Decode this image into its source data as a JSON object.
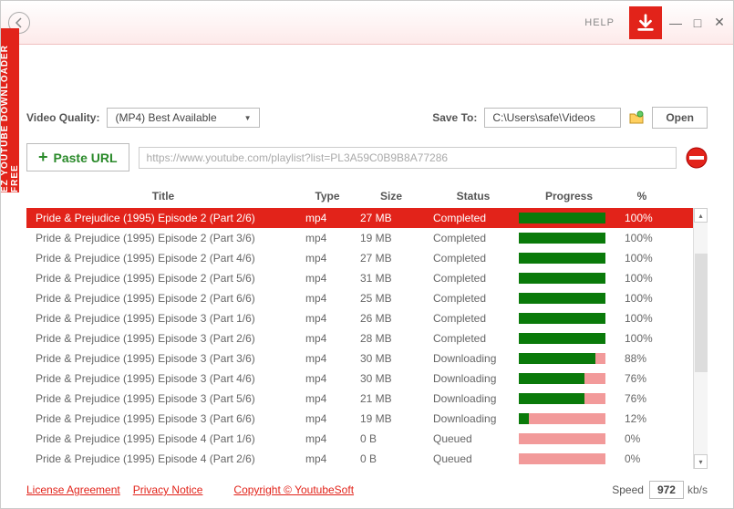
{
  "sidebar_label": "EZ YOUTUBE DOWNLOADER FREE",
  "help_label": "HELP",
  "video_quality_label": "Video Quality:",
  "video_quality_value": "(MP4) Best Available",
  "save_to_label": "Save To:",
  "save_to_path": "C:\\Users\\safe\\Videos",
  "open_label": "Open",
  "paste_url_label": "Paste URL",
  "url_value": "https://www.youtube.com/playlist?list=PL3A59C0B9B8A77286",
  "headers": {
    "title": "Title",
    "type": "Type",
    "size": "Size",
    "status": "Status",
    "progress": "Progress",
    "pct": "%"
  },
  "rows": [
    {
      "title": "Pride & Prejudice (1995) Episode 2 (Part 2/6)",
      "type": "mp4",
      "size": "27 MB",
      "status": "Completed",
      "progress": 100,
      "pct": "100%",
      "selected": true
    },
    {
      "title": "Pride & Prejudice (1995) Episode 2 (Part 3/6)",
      "type": "mp4",
      "size": "19 MB",
      "status": "Completed",
      "progress": 100,
      "pct": "100%"
    },
    {
      "title": "Pride & Prejudice (1995) Episode 2 (Part 4/6)",
      "type": "mp4",
      "size": "27 MB",
      "status": "Completed",
      "progress": 100,
      "pct": "100%"
    },
    {
      "title": "Pride & Prejudice (1995) Episode 2 (Part 5/6)",
      "type": "mp4",
      "size": "31 MB",
      "status": "Completed",
      "progress": 100,
      "pct": "100%"
    },
    {
      "title": "Pride & Prejudice (1995) Episode 2 (Part 6/6)",
      "type": "mp4",
      "size": "25 MB",
      "status": "Completed",
      "progress": 100,
      "pct": "100%"
    },
    {
      "title": "Pride & Prejudice (1995) Episode 3 (Part 1/6)",
      "type": "mp4",
      "size": "26 MB",
      "status": "Completed",
      "progress": 100,
      "pct": "100%"
    },
    {
      "title": "Pride & Prejudice (1995) Episode 3 (Part 2/6)",
      "type": "mp4",
      "size": "28 MB",
      "status": "Completed",
      "progress": 100,
      "pct": "100%"
    },
    {
      "title": "Pride & Prejudice (1995) Episode 3 (Part 3/6)",
      "type": "mp4",
      "size": "30 MB",
      "status": "Downloading",
      "progress": 88,
      "pct": "88%"
    },
    {
      "title": "Pride & Prejudice (1995) Episode 3 (Part 4/6)",
      "type": "mp4",
      "size": "30 MB",
      "status": "Downloading",
      "progress": 76,
      "pct": "76%"
    },
    {
      "title": "Pride & Prejudice (1995) Episode 3 (Part 5/6)",
      "type": "mp4",
      "size": "21 MB",
      "status": "Downloading",
      "progress": 76,
      "pct": "76%"
    },
    {
      "title": "Pride & Prejudice (1995) Episode 3 (Part 6/6)",
      "type": "mp4",
      "size": "19 MB",
      "status": "Downloading",
      "progress": 12,
      "pct": "12%"
    },
    {
      "title": "Pride & Prejudice (1995) Episode 4 (Part 1/6)",
      "type": "mp4",
      "size": "0 B",
      "status": "Queued",
      "progress": 0,
      "pct": "0%"
    },
    {
      "title": "Pride & Prejudice (1995) Episode 4 (Part 2/6)",
      "type": "mp4",
      "size": "0 B",
      "status": "Queued",
      "progress": 0,
      "pct": "0%"
    }
  ],
  "footer": {
    "license": "License Agreement",
    "privacy": "Privacy Notice",
    "copyright": "Copyright © YoutubeSoft",
    "speed_label": "Speed",
    "speed_value": "972",
    "speed_unit": "kb/s"
  }
}
